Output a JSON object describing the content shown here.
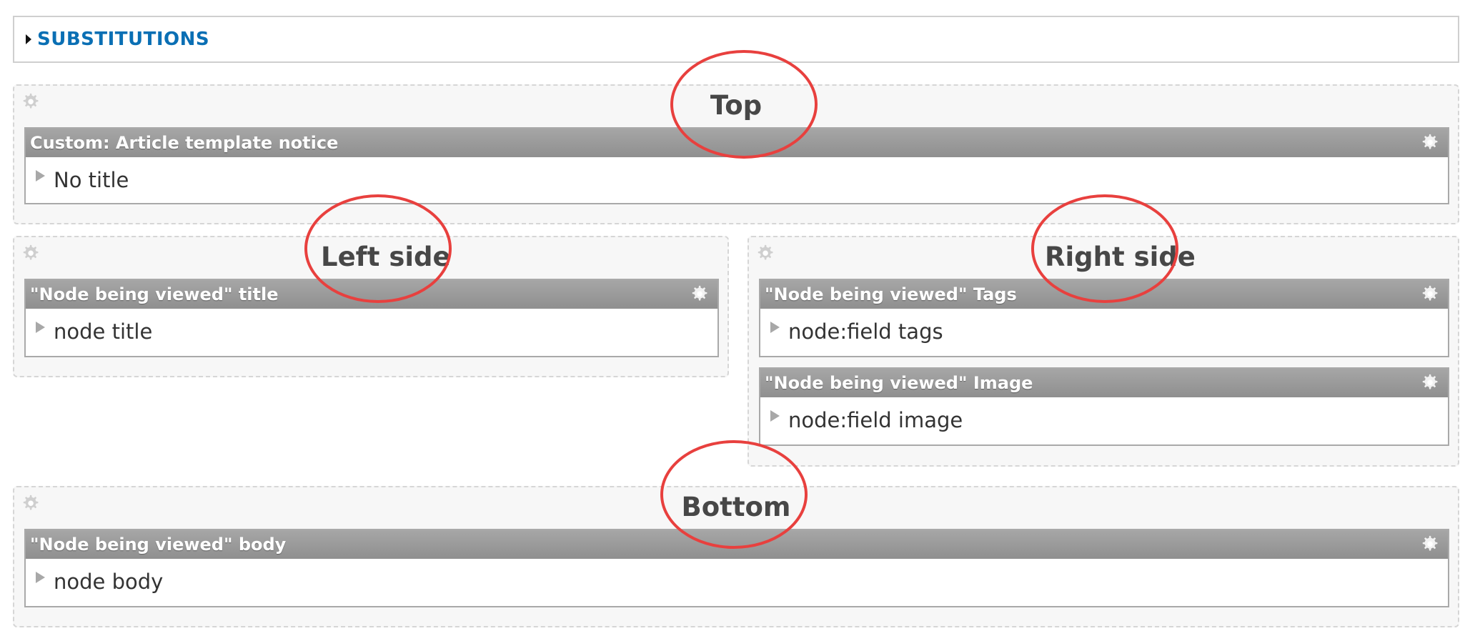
{
  "substitutions": {
    "label": "SUBSTITUTIONS"
  },
  "regions": {
    "top": {
      "title": "Top",
      "panes": [
        {
          "header": "Custom: Article template notice",
          "content": "No title"
        }
      ]
    },
    "left": {
      "title": "Left side",
      "panes": [
        {
          "header": "\"Node being viewed\" title",
          "content": "node title"
        }
      ]
    },
    "right": {
      "title": "Right side",
      "panes": [
        {
          "header": "\"Node being viewed\" Tags",
          "content": "node:field tags"
        },
        {
          "header": "\"Node being viewed\" Image",
          "content": "node:field image"
        }
      ]
    },
    "bottom": {
      "title": "Bottom",
      "panes": [
        {
          "header": "\"Node being viewed\" body",
          "content": "node body"
        }
      ]
    }
  },
  "icons": {
    "region_settings": "gear-icon",
    "pane_settings": "gear-icon",
    "expand": "triangle-right-icon"
  },
  "colors": {
    "link": "#0a6fb4",
    "annotation": "#e8403e",
    "pane_header": "#9b9b9b"
  }
}
